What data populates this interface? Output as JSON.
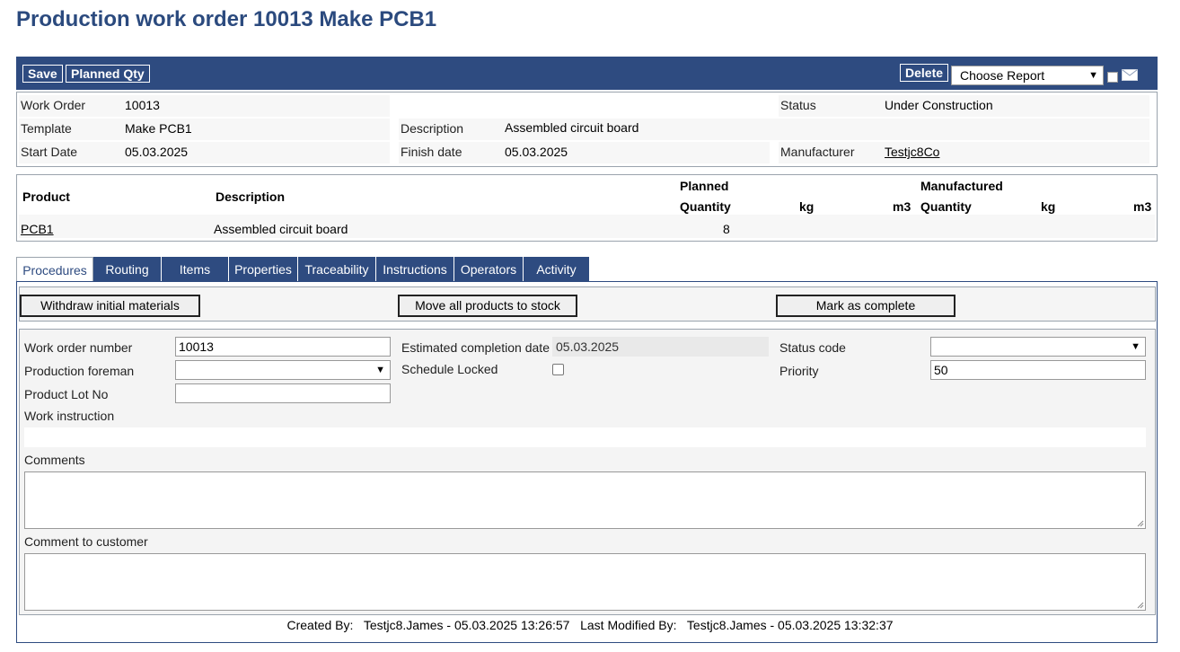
{
  "page": {
    "title": "Production work order 10013 Make PCB1"
  },
  "toolbar": {
    "save_label": "Save",
    "planned_qty_label": "Planned Qty",
    "delete_label": "Delete",
    "report_select_value": "Choose Report"
  },
  "header": {
    "work_order_label": "Work Order",
    "work_order_value": "10013",
    "status_label": "Status",
    "status_value": "Under Construction",
    "template_label": "Template",
    "template_value": "Make PCB1",
    "description_label": "Description",
    "description_value": "Assembled circuit board",
    "start_date_label": "Start Date",
    "start_date_value": "05.03.2025",
    "finish_date_label": "Finish date",
    "finish_date_value": "05.03.2025",
    "manufacturer_label": "Manufacturer",
    "manufacturer_value": "Testjc8Co"
  },
  "products": {
    "col_product": "Product",
    "col_description": "Description",
    "col_planned": "Planned",
    "col_planned_qty": "Quantity",
    "col_kg": "kg",
    "col_m3": "m3",
    "col_manufactured": "Manufactured",
    "col_manufactured_qty": "Quantity",
    "col_manufactured_kg": "kg",
    "col_manufactured_m3": "m3",
    "rows": [
      {
        "product": "PCB1",
        "description": "Assembled circuit board",
        "planned_qty": "8"
      }
    ]
  },
  "tabs": [
    {
      "label": "Procedures"
    },
    {
      "label": "Routing"
    },
    {
      "label": "Items"
    },
    {
      "label": "Properties"
    },
    {
      "label": "Traceability"
    },
    {
      "label": "Instructions"
    },
    {
      "label": "Operators"
    },
    {
      "label": "Activity"
    }
  ],
  "actions": {
    "withdraw_label": "Withdraw initial materials",
    "move_label": "Move all products to stock",
    "complete_label": "Mark as complete"
  },
  "form": {
    "work_order_number_label": "Work order number",
    "work_order_number_value": "10013",
    "est_completion_label": "Estimated completion date",
    "est_completion_value": "05.03.2025",
    "status_code_label": "Status code",
    "status_code_value": "",
    "production_foreman_label": "Production foreman",
    "production_foreman_value": "",
    "schedule_locked_label": "Schedule Locked",
    "priority_label": "Priority",
    "priority_value": "50",
    "product_lot_label": "Product Lot No",
    "product_lot_value": "",
    "work_instruction_label": "Work instruction",
    "comments_label": "Comments",
    "comment_customer_label": "Comment to customer"
  },
  "footer": {
    "created_by_label": "Created By:",
    "created_by_value": "Testjc8.James - 05.03.2025 13:26:57",
    "modified_by_label": "Last Modified By:",
    "modified_by_value": "Testjc8.James - 05.03.2025 13:32:37"
  }
}
